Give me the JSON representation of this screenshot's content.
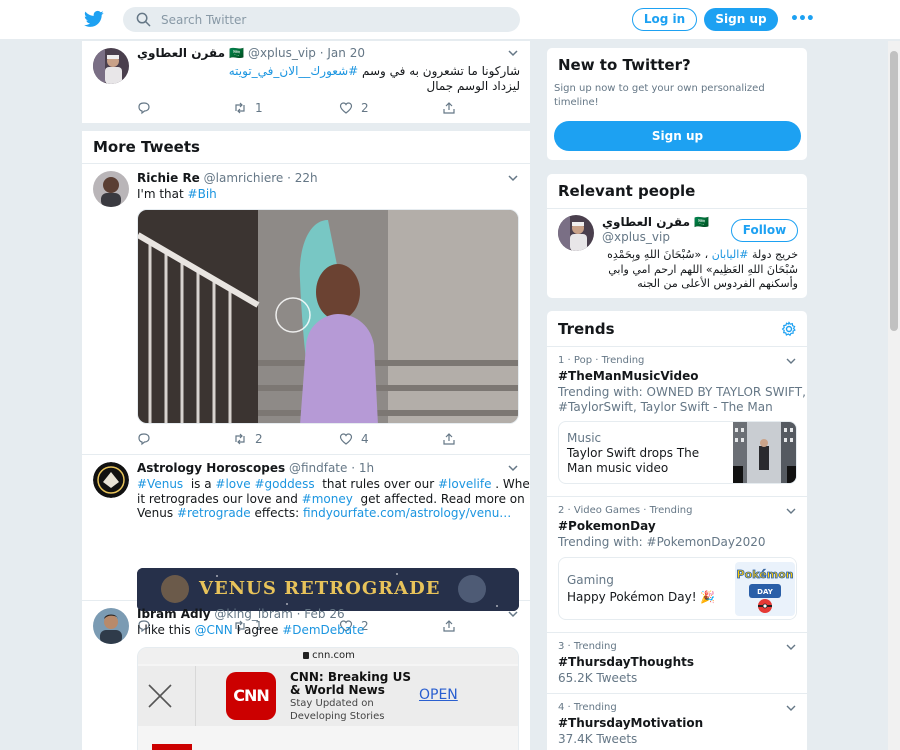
{
  "header": {
    "search_placeholder": "Search Twitter",
    "login_label": "Log in",
    "signup_label": "Sign up",
    "more_label": "•••"
  },
  "timeline": {
    "top_tweet": {
      "name": "مقرن العطاوي 🇸🇦",
      "handle": "@xplus_vip",
      "date": "· Jan 20",
      "text_line1_prefix": "شاركونا ما تشعرون به في وسم ",
      "text_line1_hashtag": "#شعورك__الان_في_تويته",
      "text_line2": "ليزداد الوسم جمال",
      "replies": "",
      "retweets": "1",
      "likes": "2"
    },
    "more_tweets_title": "More Tweets",
    "tweets": [
      {
        "name": "Richie Re",
        "handle": "@lamrichiere",
        "date": "· 22h",
        "text": "I'm that ",
        "hashtag": "#Bih",
        "retweets": "2",
        "likes": "4"
      },
      {
        "name": "Astrology Horoscopes",
        "handle": "@findfate",
        "date": "· 1h",
        "h1": "#Venus",
        "t1": "  is a ",
        "h2": "#love",
        "h3": "#goddess",
        "t2": "  that rules over our ",
        "h4": "#lovelife",
        "t3": " . When",
        "t4": "it retrogrades our love and ",
        "h5": "#money",
        "t5": "  get affected. Read more on",
        "t6": "Venus ",
        "h6": "#retrograde",
        "t7": " effects: ",
        "link": "findyourfate.com/astrology/venu…",
        "banner_text": "VENUS RETROGRADE",
        "retweets": "1",
        "likes": "2"
      },
      {
        "name": "Ibram Adly",
        "handle": "@king_ibram",
        "date": "· Feb 26",
        "t1": "I like this ",
        "m1": "@CNN",
        "t2": " I agree ",
        "h1": "#DemDebate",
        "browser_url": "cnn.com",
        "app_logo": "CNN",
        "app_title_1": "CNN: Breaking US",
        "app_title_2": "& World News",
        "app_sub_1": "Stay Updated on",
        "app_sub_2": "Developing Stories",
        "app_open": "OPEN"
      }
    ]
  },
  "sidebar": {
    "new_card": {
      "title": "New to Twitter?",
      "desc_1": "Sign up now to get your own personalized",
      "desc_2": "timeline!",
      "button": "Sign up"
    },
    "relevant": {
      "title": "Relevant people",
      "name": "مقرن العطاوي 🇸🇦",
      "handle": "@xplus_vip",
      "follow": "Follow",
      "bio_1_prefix": "خريج دولة ",
      "bio_1_hashtag": "#اليابان",
      "bio_1_suffix": " ، «سُبْحَانَ اللهِ وبِحَمْدِه",
      "bio_2": "سُبْحَانَ اللهِ العَظِيم» اللهم ارحم امي وابي",
      "bio_3": "وأسكنهم الفردوس الأعلى من الجنه"
    },
    "trends": {
      "title": "Trends",
      "items": [
        {
          "meta": "1 · Pop · Trending",
          "tag": "#TheManMusicVideo",
          "sub_1": "Trending with: OWNED BY TAYLOR SWIFT,",
          "sub_2": "#TaylorSwift, Taylor Swift - The Man",
          "event_cat": "Music",
          "event_title": "Taylor Swift drops The Man music video"
        },
        {
          "meta": "2 · Video Games · Trending",
          "tag": "#PokemonDay",
          "sub_1": "Trending with: #PokemonDay2020",
          "event_cat": "Gaming",
          "event_title": "Happy Pokémon Day! 🎉"
        },
        {
          "meta": "3 · Trending",
          "tag": "#ThursdayThoughts",
          "sub_1": "65.2K Tweets"
        },
        {
          "meta": "4 · Trending",
          "tag": "#ThursdayMotivation",
          "sub_1": "37.4K Tweets"
        }
      ]
    }
  },
  "colors": {
    "brand_blue": "#1da1f2",
    "link_blue": "#1b95e0",
    "background": "#e6ecf0"
  }
}
